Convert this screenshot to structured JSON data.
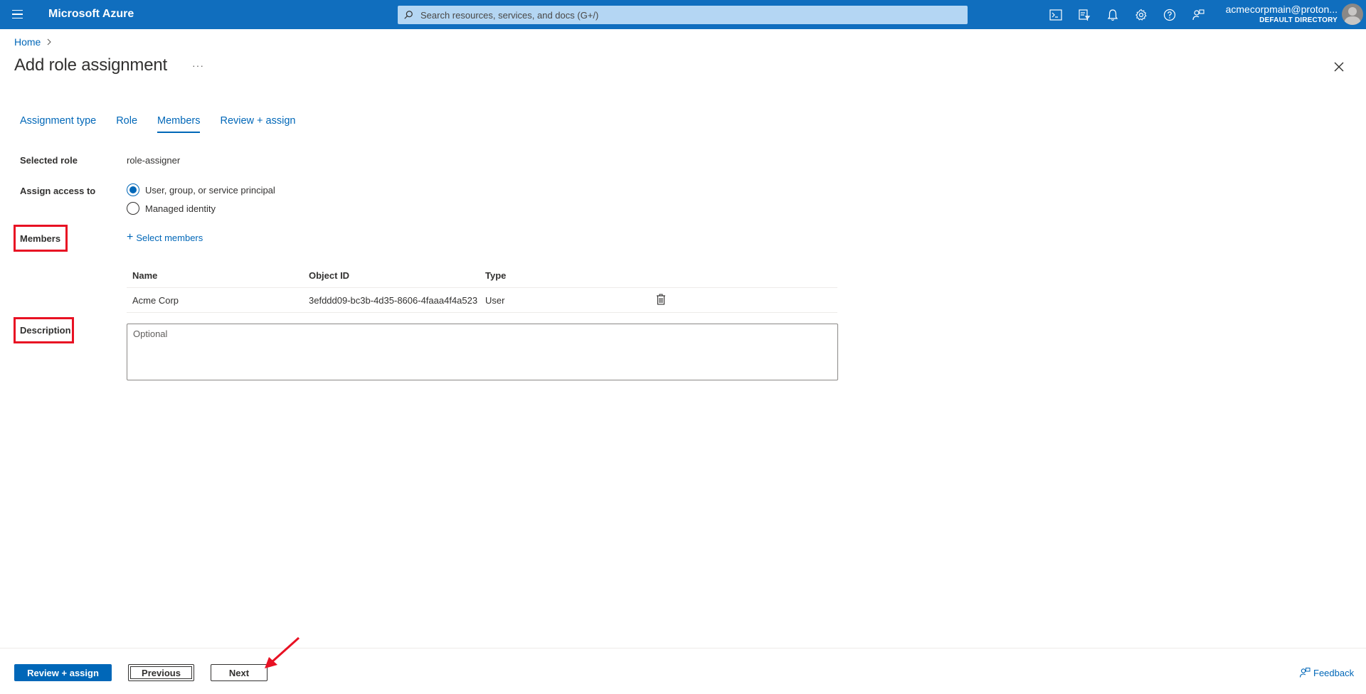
{
  "topbar": {
    "brand": "Microsoft Azure",
    "search_placeholder": "Search resources, services, and docs (G+/)",
    "account_name": "acmecorpmain@proton...",
    "account_directory": "DEFAULT DIRECTORY"
  },
  "breadcrumb": {
    "home": "Home"
  },
  "page": {
    "title": "Add role assignment",
    "more": "···"
  },
  "tabs": [
    {
      "label": "Assignment type",
      "active": false
    },
    {
      "label": "Role",
      "active": false
    },
    {
      "label": "Members",
      "active": true
    },
    {
      "label": "Review + assign",
      "active": false
    }
  ],
  "form": {
    "selected_role_label": "Selected role",
    "selected_role_value": "role-assigner",
    "assign_access_label": "Assign access to",
    "assign_options": [
      {
        "label": "User, group, or service principal",
        "checked": true
      },
      {
        "label": "Managed identity",
        "checked": false
      }
    ],
    "members_label": "Members",
    "select_members": "Select members",
    "description_label": "Description",
    "description_placeholder": "Optional"
  },
  "members_table": {
    "columns": [
      "Name",
      "Object ID",
      "Type"
    ],
    "rows": [
      {
        "name": "Acme Corp",
        "object_id": "3efddd09-bc3b-4d35-8606-4faaa4f4a523",
        "type": "User"
      }
    ]
  },
  "footer": {
    "review_assign": "Review + assign",
    "previous": "Previous",
    "next": "Next",
    "feedback": "Feedback"
  },
  "colors": {
    "topbar": "#106ebe",
    "accent": "#0067b8",
    "highlight": "#e81123"
  }
}
